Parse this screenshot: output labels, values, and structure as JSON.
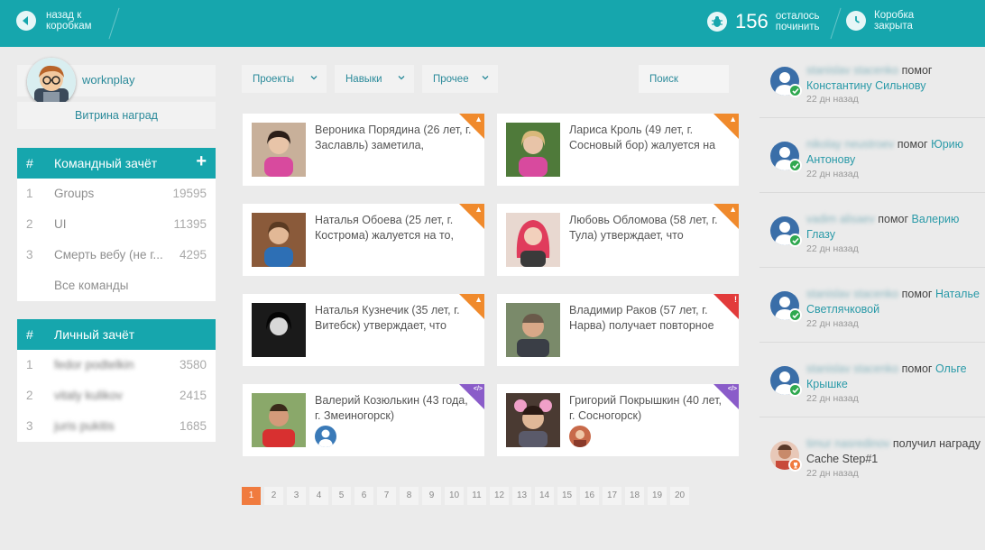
{
  "header": {
    "back_label_1": "назад к",
    "back_label_2": "коробкам",
    "remaining_count": "156",
    "remaining_label_1": "осталось",
    "remaining_label_2": "починить",
    "box_label_1": "Коробка",
    "box_label_2": "закрыта"
  },
  "profile": {
    "username": "worknplay",
    "awards_label": "Витрина наград"
  },
  "team_ranking": {
    "hash": "#",
    "title": "Командный зачёт",
    "plus": "+",
    "rows": [
      {
        "n": "1",
        "name": "Groups",
        "score": "19595"
      },
      {
        "n": "2",
        "name": "UI",
        "score": "11395"
      },
      {
        "n": "3",
        "name": "Смерть вебу (не г...",
        "score": "4295"
      }
    ],
    "all_label": "Все команды"
  },
  "personal_ranking": {
    "hash": "#",
    "title": "Личный зачёт",
    "rows": [
      {
        "n": "1",
        "name": "fedor podtelkin",
        "score": "3580"
      },
      {
        "n": "2",
        "name": "vitaly kulikov",
        "score": "2415"
      },
      {
        "n": "3",
        "name": "juris pukitis",
        "score": "1685"
      }
    ]
  },
  "filters": [
    {
      "label": "Проекты"
    },
    {
      "label": "Навыки"
    },
    {
      "label": "Прочее"
    }
  ],
  "search": {
    "placeholder": "Поиск"
  },
  "cards": [
    {
      "text": "Вероника Порядина (26 лет, г. Заславль) заметила,",
      "corner": "#f08a2c",
      "glyph": "▲"
    },
    {
      "text": "Лариса Кроль (49 лет, г. Сосновый бор) жалуется на",
      "corner": "#f08a2c",
      "glyph": "▲"
    },
    {
      "text": "Наталья Обоева (25 лет, г. Кострома) жалуется на то,",
      "corner": "#f08a2c",
      "glyph": "▲"
    },
    {
      "text": "Любовь Обломова (58 лет, г. Тула) утверждает, что",
      "corner": "#f08a2c",
      "glyph": "▲"
    },
    {
      "text": "Наталья Кузнечик (35 лет, г. Витебск) утверждает, что",
      "corner": "#f08a2c",
      "glyph": "▲"
    },
    {
      "text": "Владимир Раков (57 лет, г. Нарва) получает повторное",
      "corner": "#e23b3b",
      "glyph": "!"
    },
    {
      "text": "Валерий Козюлькин (43 года, г. Змеиногорск)",
      "corner": "#8a5cc9",
      "glyph": "</>"
    },
    {
      "text": "Григорий Покрышкин (40 лет, г. Сосногорск)",
      "corner": "#8a5cc9",
      "glyph": "</>"
    }
  ],
  "pages": [
    "1",
    "2",
    "3",
    "4",
    "5",
    "6",
    "7",
    "8",
    "9",
    "10",
    "11",
    "12",
    "13",
    "14",
    "15",
    "16",
    "17",
    "18",
    "19",
    "20"
  ],
  "current_page": 1,
  "feed": [
    {
      "who": "stanislav stacenko",
      "verb": "помог",
      "target": "Константину Сильнову",
      "time": "22 дн назад",
      "badge": "help"
    },
    {
      "who": "nikolay neustroev",
      "verb": "помог",
      "target": "Юрию Антонову",
      "time": "22 дн назад",
      "badge": "help"
    },
    {
      "who": "vadim alisaev",
      "verb": "помог",
      "target": "Валерию Глазу",
      "time": "22 дн назад",
      "badge": "help"
    },
    {
      "who": "stanislav stacenko",
      "verb": "помог",
      "target": "Наталье Светлячковой",
      "time": "22 дн назад",
      "badge": "help"
    },
    {
      "who": "stanislav stacenko",
      "verb": "помог",
      "target": "Ольге Крышке",
      "time": "22 дн назад",
      "badge": "help"
    },
    {
      "who": "timur nasredinov",
      "verb": "получил награду Cache Step#1",
      "target": "",
      "time": "22 дн назад",
      "badge": "award"
    }
  ],
  "colors": {
    "accent": "#16a6ad",
    "active_page": "#f07b3f",
    "link": "#2a9aa8",
    "badge_green": "#2fa84f",
    "badge_orange": "#f07b3f"
  }
}
